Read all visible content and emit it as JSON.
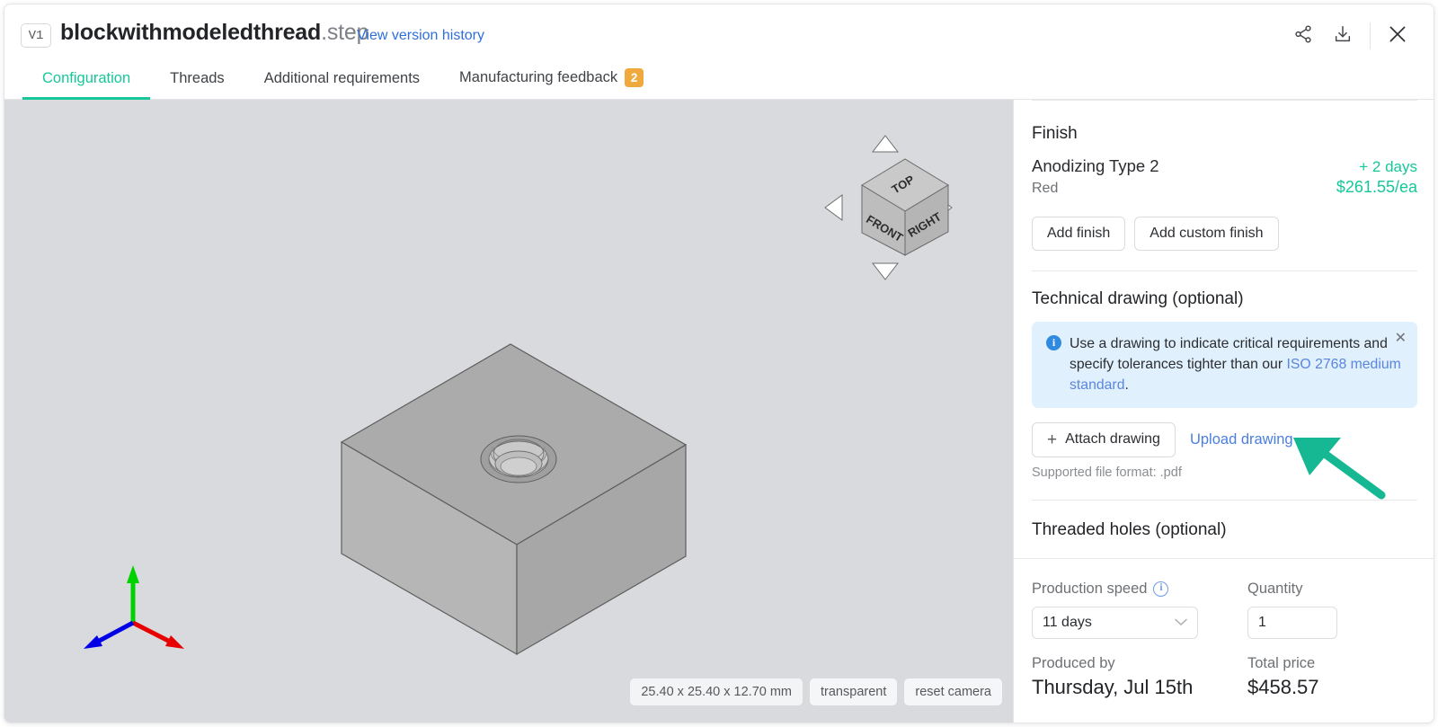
{
  "header": {
    "version_badge": "V1",
    "file_name": "blockwithmodeledthread",
    "file_ext": ".step",
    "version_history_link": "View version history",
    "share_icon": "share-icon",
    "download_icon": "download-icon",
    "close_icon": "close-icon"
  },
  "tabs": [
    {
      "label": "Configuration",
      "active": true,
      "badge": ""
    },
    {
      "label": "Threads",
      "active": false,
      "badge": ""
    },
    {
      "label": "Additional requirements",
      "active": false,
      "badge": ""
    },
    {
      "label": "Manufacturing feedback",
      "active": false,
      "badge": "2"
    }
  ],
  "viewport": {
    "background_color": "#d8dadd",
    "viewcube": {
      "top_face": "TOP",
      "front_face": "FRONT",
      "right_face": "RIGHT",
      "arrow_up": "rotate-up-arrow",
      "arrow_down": "rotate-down-arrow",
      "arrow_left": "rotate-left-arrow",
      "arrow_right": "rotate-right-arrow"
    },
    "axis_gizmo": {
      "y_axis_color": "#00d200",
      "x_axis_color": "#e60000",
      "z_axis_color": "#0000e6"
    },
    "toolbar": {
      "dimensions": "25.40 x 25.40 x 12.70 mm",
      "transparent": "transparent",
      "reset_camera": "reset camera"
    }
  },
  "panel": {
    "finish": {
      "title": "Finish",
      "name": "Anodizing Type 2",
      "days": "+ 2 days",
      "color": "Red",
      "price": "$261.55/ea",
      "add_finish": "Add finish",
      "add_custom_finish": "Add custom finish"
    },
    "technical_drawing": {
      "title": "Technical drawing (optional)",
      "info_text_part1": "Use a drawing to indicate critical requirements and specify tolerances tighter than our ",
      "info_link": "ISO 2768 medium standard",
      "info_text_part2": ".",
      "attach_button": "Attach drawing",
      "attach_plus": "+",
      "upload_link": "Upload drawing",
      "supported_hint": "Supported file format: .pdf"
    },
    "threaded_holes": {
      "title": "Threaded holes (optional)"
    },
    "summary": {
      "production_speed_label": "Production speed",
      "production_speed_value": "11 days",
      "quantity_label": "Quantity",
      "quantity_value": "1",
      "produced_by_label": "Produced by",
      "produced_by_value": "Thursday, Jul 15th",
      "total_price_label": "Total price",
      "total_price_value": "$458.57"
    }
  },
  "annotation": {
    "arrow_color": "#16b894",
    "points_to": "Upload drawing"
  },
  "colors": {
    "accent_teal": "#16c79a",
    "badge_orange": "#f0a93c",
    "link_blue": "#2f6fdd",
    "info_blue_bg": "#e0f0fd"
  }
}
